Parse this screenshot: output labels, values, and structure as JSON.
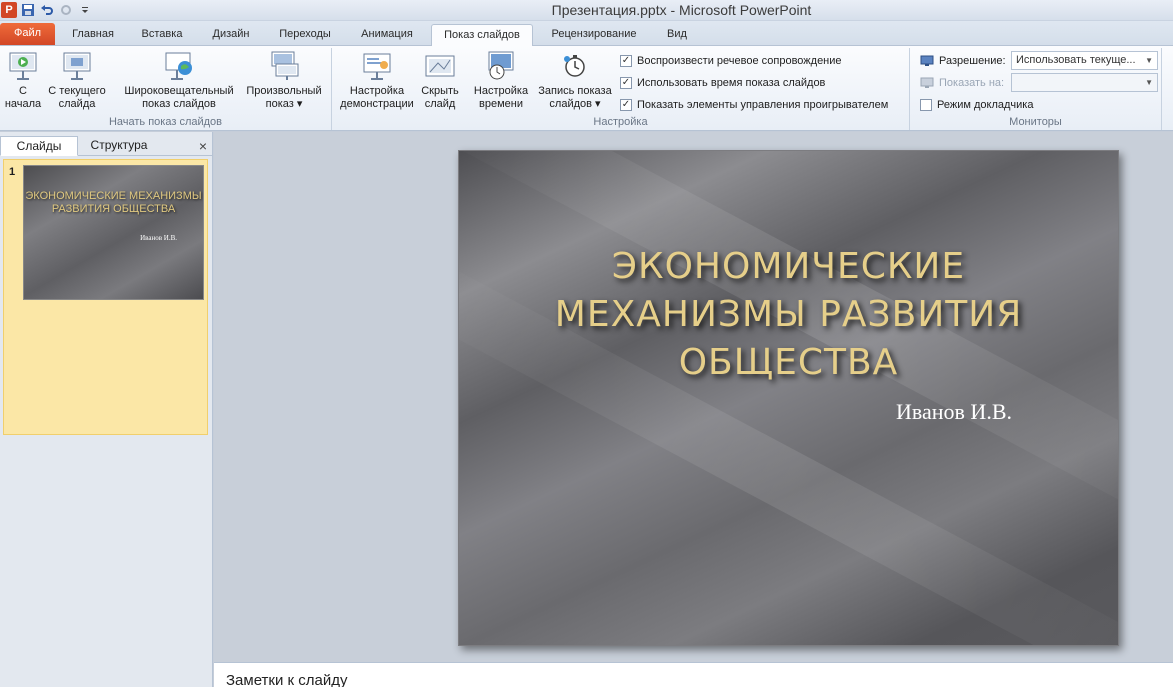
{
  "window": {
    "title": "Презентация.pptx - Microsoft PowerPoint"
  },
  "tabs": {
    "file": "Файл",
    "home": "Главная",
    "insert": "Вставка",
    "design": "Дизайн",
    "transitions": "Переходы",
    "animation": "Анимация",
    "slideshow": "Показ слайдов",
    "review": "Рецензирование",
    "view": "Вид"
  },
  "ribbon": {
    "start_group": {
      "label": "Начать показ слайдов",
      "from_start": [
        "С",
        "начала"
      ],
      "from_current": [
        "С текущего",
        "слайда"
      ],
      "broadcast": [
        "Широковещательный",
        "показ слайдов"
      ],
      "custom": [
        "Произвольный",
        "показ ▾"
      ]
    },
    "setup_group": {
      "label": "Настройка",
      "setup_show": [
        "Настройка",
        "демонстрации"
      ],
      "hide_slide": [
        "Скрыть",
        "слайд"
      ],
      "rehearse": [
        "Настройка",
        "времени"
      ],
      "record": [
        "Запись показа",
        "слайдов ▾"
      ],
      "play_narrations": "Воспроизвести речевое сопровождение",
      "use_timings": "Использовать время показа слайдов",
      "show_controls": "Показать элементы управления проигрывателем"
    },
    "monitors_group": {
      "label": "Мониторы",
      "resolution_label": "Разрешение:",
      "resolution_value": "Использовать текуще...",
      "show_on_label": "Показать на:",
      "presenter_view": "Режим докладчика"
    }
  },
  "left_pane": {
    "tab_slides": "Слайды",
    "tab_outline": "Структура",
    "close": "×",
    "slide_number": "1",
    "thumb_title": "ЭКОНОМИЧЕСКИЕ МЕХАНИЗМЫ РАЗВИТИЯ ОБЩЕСТВА",
    "thumb_author": "Иванов И.В."
  },
  "slide": {
    "title_line1": "ЭКОНОМИЧЕСКИЕ",
    "title_line2": "МЕХАНИЗМЫ РАЗВИТИЯ",
    "title_line3": "ОБЩЕСТВА",
    "author": "Иванов И.В."
  },
  "notes": {
    "placeholder": "Заметки к слайду"
  }
}
